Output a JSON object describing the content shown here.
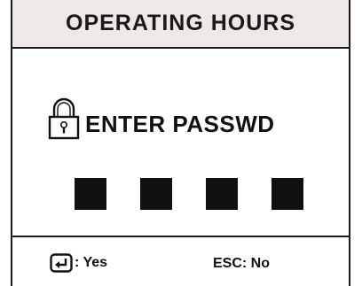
{
  "header": {
    "title": "OPERATING HOURS"
  },
  "prompt": {
    "icon": "lock-icon",
    "text": "ENTER PASSWD"
  },
  "code": {
    "digits_total": 4,
    "digits_entered": 0,
    "box_color": "#111111"
  },
  "footer": {
    "yes_icon": "enter-key-icon",
    "yes_label": ": Yes",
    "no_label": "ESC: No"
  },
  "colors": {
    "header_background": "#efe9e5",
    "border": "#1a1a1a",
    "background": "#ffffff"
  }
}
